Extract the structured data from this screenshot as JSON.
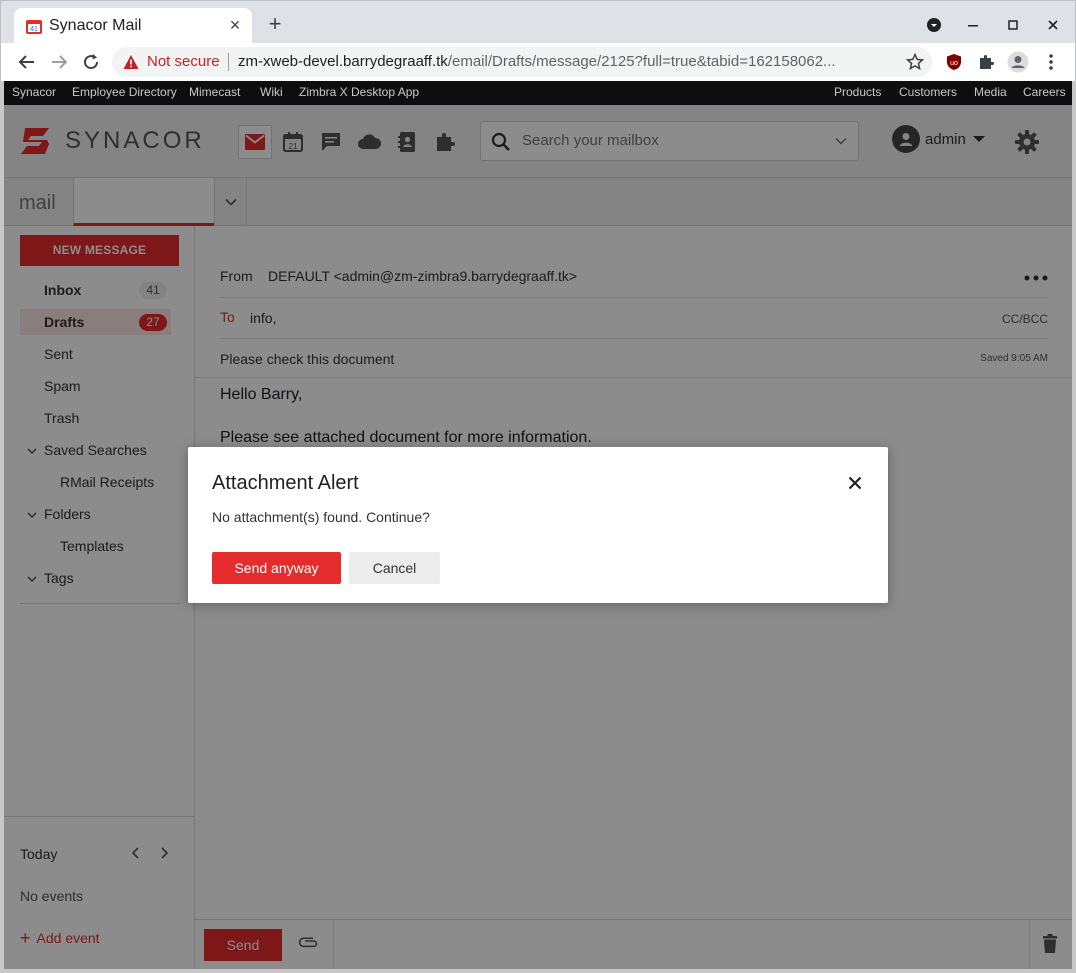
{
  "browser": {
    "tab_title": "Synacor Mail",
    "favicon_badge": "41",
    "security_label": "Not secure",
    "url_host": "zm-xweb-devel.barrydegraaff.tk",
    "url_path": "/email/Drafts/message/2125?full=true&tabid=162158062..."
  },
  "portal_links": {
    "left": [
      "Synacor",
      "Employee Directory",
      "Mimecast",
      "Wiki",
      "Zimbra X Desktop App"
    ],
    "right": [
      "Products",
      "Customers",
      "Media",
      "Careers"
    ]
  },
  "header": {
    "brand": "SYNACOR",
    "calendar_day": "21",
    "search_placeholder": "Search your mailbox",
    "username": "admin"
  },
  "tabs": {
    "app_label": "mail"
  },
  "sidebar": {
    "new_message": "NEW MESSAGE",
    "folders": [
      {
        "name": "Inbox",
        "count": "41"
      },
      {
        "name": "Drafts",
        "count": "27"
      },
      {
        "name": "Sent"
      },
      {
        "name": "Spam"
      },
      {
        "name": "Trash"
      }
    ],
    "saved_searches": {
      "label": "Saved Searches",
      "items": [
        "RMail Receipts"
      ]
    },
    "folders_group": {
      "label": "Folders",
      "items": [
        "Templates"
      ]
    },
    "tags_label": "Tags",
    "calendar": {
      "today": "Today",
      "no_events": "No events",
      "add_event": "Add event"
    }
  },
  "compose": {
    "from_label": "From",
    "from_value": "DEFAULT <admin@zm-zimbra9.barrydegraaff.tk>",
    "to_label": "To",
    "to_value": "info,",
    "cc_bcc": "CC/BCC",
    "subject": "Please check this document",
    "saved_status": "Saved 9:05 AM",
    "body_line1": "Hello Barry,",
    "body_line2": "Please see attached document for more information.",
    "send": "Send"
  },
  "modal": {
    "title": "Attachment Alert",
    "message": "No attachment(s) found. Continue?",
    "primary": "Send anyway",
    "secondary": "Cancel"
  },
  "colors": {
    "brand_red": "#e52c2c",
    "portal_bar": "#0e0e10"
  }
}
